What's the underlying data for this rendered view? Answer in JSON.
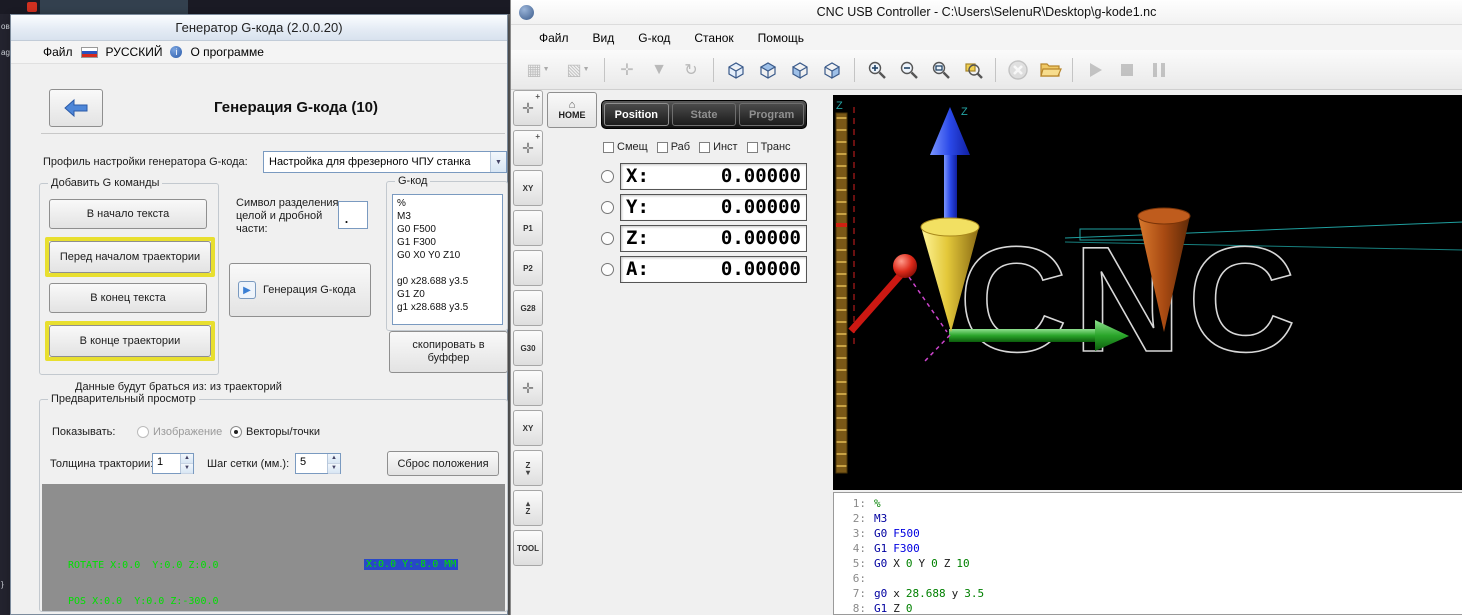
{
  "background": {
    "left_strip_fragments": [
      "ов",
      "agе",
      "}"
    ]
  },
  "generator": {
    "title": "Генератор G-кода (2.0.0.20)",
    "menu": {
      "file": "Файл",
      "language": "РУССКИЙ",
      "about": "О программе"
    },
    "header": "Генерация G-кода (10)",
    "profile": {
      "label": "Профиль настройки генератора G-кода:",
      "value": "Настройка для фрезерного ЧПУ станка"
    },
    "add_commands": {
      "title": "Добавить G команды",
      "buttons": [
        "В начало текста",
        "Перед началом траектории",
        "В конец текста",
        "В конце траектории"
      ]
    },
    "decimal": {
      "label": "Символ разделения целой и дробной части:",
      "value": "."
    },
    "generate_button": "Генерация G-кода",
    "gcode": {
      "title": "G-код",
      "text": "%\nM3\nG0 F500\nG1 F300\nG0 X0 Y0 Z10\n\ng0 x28.688 y3.5\nG1 Z0\ng1 x28.688 y3.5"
    },
    "copy_button": "скопировать в буффер",
    "source_note": "Данные будут браться из: из траекторий",
    "preview": {
      "title": "Предварительный просмотр",
      "show_label": "Показывать:",
      "options": [
        "Изображение",
        "Векторы/точки"
      ],
      "selected_option": "Векторы/точки",
      "thickness_label": "Толщина трактории:",
      "thickness_value": "1",
      "grid_label": "Шаг сетки (мм.):",
      "grid_value": "5",
      "reset_button": "Сброс положения",
      "rotate_readout": "ROTATE X:0.0  Y:0.0 Z:0.0",
      "pos_readout": "POS X:0.0  Y:0.0 Z:-300.0",
      "cursor_readout": "X:0.0 Y:-8.0 MM"
    }
  },
  "cnc": {
    "title": "CNC USB Controller - C:\\Users\\SelenuR\\Desktop\\g-kode1.nc",
    "menu": [
      "Файл",
      "Вид",
      "G-код",
      "Станок",
      "Помощь"
    ],
    "toolbar_icons": [
      "machine-setup-icon",
      "machine-offset-icon",
      "axes-icon",
      "filter-icon",
      "rotate-icon",
      "view-perspective-icon",
      "view-top-icon",
      "view-front-icon",
      "view-side-icon",
      "zoom-in-icon",
      "zoom-out-icon",
      "zoom-extents-icon",
      "zoom-window-icon",
      "abort-icon",
      "open-file-icon",
      "run-icon",
      "stop-icon",
      "pause-icon"
    ],
    "home_button": "HOME",
    "sidebar": [
      {
        "label": "",
        "icon": "jog-plus"
      },
      {
        "label": "",
        "icon": "jog-plus"
      },
      {
        "label": "XY",
        "icon": ""
      },
      {
        "label": "P1",
        "icon": ""
      },
      {
        "label": "P2",
        "icon": ""
      },
      {
        "label": "G28",
        "icon": ""
      },
      {
        "label": "G30",
        "icon": ""
      },
      {
        "label": "",
        "icon": "jog"
      },
      {
        "label": "XY",
        "icon": ""
      },
      {
        "label": "Z",
        "icon": "down"
      },
      {
        "label": "Z",
        "icon": "up"
      },
      {
        "label": "TOOL",
        "icon": ""
      }
    ],
    "tabs": [
      "Position",
      "State",
      "Program"
    ],
    "active_tab": "Position",
    "checkboxes": [
      "Смещ",
      "Раб",
      "Инст",
      "Транс"
    ],
    "dro": [
      {
        "axis": "X:",
        "value": "0.00000"
      },
      {
        "axis": "Y:",
        "value": "0.00000"
      },
      {
        "axis": "Z:",
        "value": "0.00000"
      },
      {
        "axis": "A:",
        "value": "0.00000"
      }
    ],
    "viewport": {
      "z_label": "Z",
      "engraving_text": "CNC"
    },
    "listing": [
      {
        "n": "1:",
        "tokens": [
          {
            "c": "pct",
            "t": "%"
          }
        ]
      },
      {
        "n": "2:",
        "tokens": [
          {
            "c": "gm",
            "t": "M3"
          }
        ]
      },
      {
        "n": "3:",
        "tokens": [
          {
            "c": "gm",
            "t": "G0"
          },
          {
            "c": "f",
            "t": "F500"
          }
        ]
      },
      {
        "n": "4:",
        "tokens": [
          {
            "c": "gm",
            "t": "G1"
          },
          {
            "c": "f",
            "t": "F300"
          }
        ]
      },
      {
        "n": "5:",
        "tokens": [
          {
            "c": "gm",
            "t": "G0"
          },
          {
            "c": "ax",
            "t": "X"
          },
          {
            "c": "num",
            "t": "0"
          },
          {
            "c": "ax",
            "t": "Y"
          },
          {
            "c": "num",
            "t": "0"
          },
          {
            "c": "ax",
            "t": "Z"
          },
          {
            "c": "num",
            "t": "10"
          }
        ]
      },
      {
        "n": "6:",
        "tokens": []
      },
      {
        "n": "7:",
        "tokens": [
          {
            "c": "gm",
            "t": "g0"
          },
          {
            "c": "ax",
            "t": "x"
          },
          {
            "c": "num",
            "t": "28.688"
          },
          {
            "c": "ax",
            "t": "y"
          },
          {
            "c": "num",
            "t": "3.5"
          }
        ]
      },
      {
        "n": "8:",
        "tokens": [
          {
            "c": "gm",
            "t": "G1"
          },
          {
            "c": "ax",
            "t": "Z"
          },
          {
            "c": "num",
            "t": "0"
          }
        ]
      }
    ],
    "colors": {
      "axis_x": "#cc1812",
      "axis_y": "#2aa52a",
      "axis_z": "#2a48e8",
      "tool_cone": "#e3c83a",
      "target_cone": "#a84a12",
      "path": "#1f9f9f"
    }
  }
}
